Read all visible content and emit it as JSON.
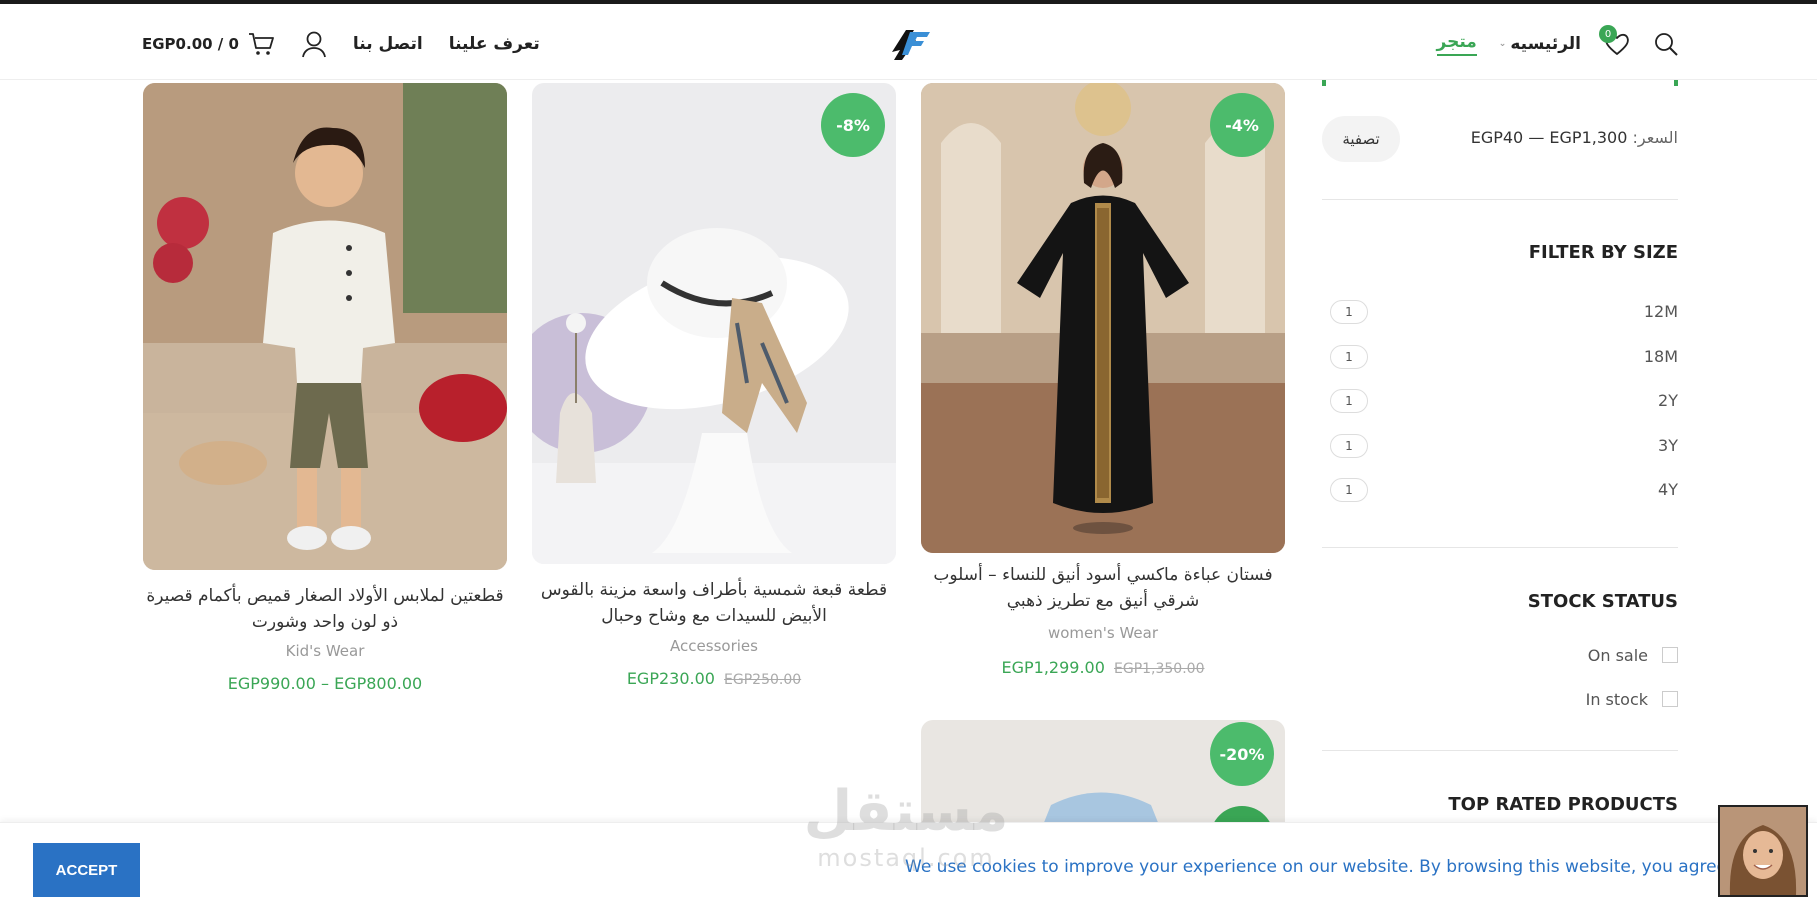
{
  "header": {
    "cart_total": "EGP0.00 / 0",
    "nav_about": "تعرف علينا",
    "nav_contact": "اتصل بنا",
    "nav_shop": "متجر",
    "nav_home": "الرئيسيه",
    "wishlist_count": "0",
    "logo_text": "SF"
  },
  "products": [
    {
      "title": "فستان عباءة ماكسي أسود أنيق للنساء – أسلوب شرقي أنيق مع تطريز ذهبي",
      "category": "women's Wear",
      "price": "EGP1,299.00",
      "old_price": "EGP1,350.00",
      "badge": "-4%"
    },
    {
      "title": "قطعة قبعة شمسية بأطراف واسعة مزينة بالقوس الأبيض للسيدات مع وشاح وحبال",
      "category": "Accessories",
      "price": "EGP230.00",
      "old_price": "EGP250.00",
      "badge": "-8%"
    },
    {
      "title": "قطعتين لملابس الأولاد الصغار قميص بأكمام قصيرة ذو لون واحد وشورت",
      "category": "Kid's Wear",
      "price": "EGP990.00 – EGP800.00",
      "old_price": "",
      "badge": ""
    },
    {
      "badge": "-20%"
    }
  ],
  "sidebar": {
    "price_label": "السعر:",
    "price_range": "EGP40 — EGP1,300",
    "filter_button": "تصفية",
    "size_heading": "FILTER BY SIZE",
    "sizes": [
      {
        "label": "12M",
        "count": "1"
      },
      {
        "label": "18M",
        "count": "1"
      },
      {
        "label": "2Y",
        "count": "1"
      },
      {
        "label": "3Y",
        "count": "1"
      },
      {
        "label": "4Y",
        "count": "1"
      }
    ],
    "stock_heading": "STOCK STATUS",
    "stock_options": [
      "On sale",
      "In stock"
    ],
    "top_rated_heading": "TOP RATED PRODUCTS"
  },
  "cookie": {
    "accept": "ACCEPT",
    "text": "We use cookies to improve your experience on our website. By browsing this website, you agree to our use of cookies."
  },
  "watermark": {
    "ar": "مستقل",
    "en": "mostaql.com"
  },
  "colors": {
    "accent_green": "#3aa655",
    "badge_green": "#4cbb6c",
    "accept_blue": "#2a72c4"
  }
}
